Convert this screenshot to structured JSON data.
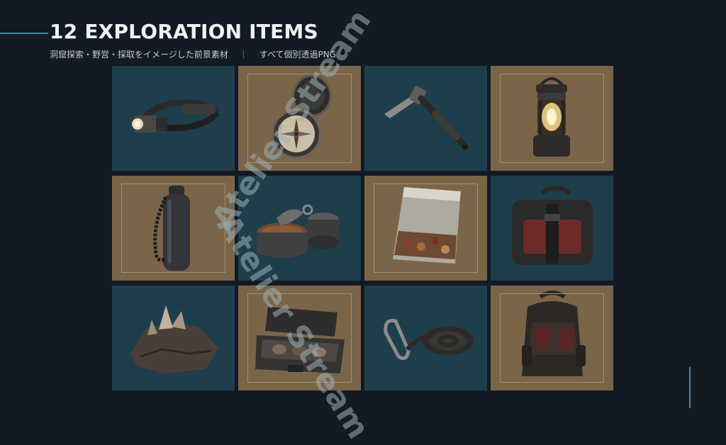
{
  "header": {
    "title": "12 EXPLORATION ITEMS",
    "subtitle": "洞窟探索・野営・採取をイメージした前景素材",
    "separator": "｜",
    "note": "すべて個別透過PNG"
  },
  "watermark": "Atelier Stream",
  "colors": {
    "background": "#121a24",
    "tile_teal": "#1e3e4b",
    "tile_sand": "#7b6548",
    "accent": "#3f8ea0"
  },
  "items": [
    {
      "icon": "headlamp-icon",
      "tile": "teal"
    },
    {
      "icon": "compass-icon",
      "tile": "sand"
    },
    {
      "icon": "pickaxe-hammer-icon",
      "tile": "teal"
    },
    {
      "icon": "lantern-icon",
      "tile": "sand"
    },
    {
      "icon": "water-bottle-icon",
      "tile": "sand"
    },
    {
      "icon": "tin-cans-icon",
      "tile": "teal"
    },
    {
      "icon": "food-pouch-icon",
      "tile": "sand"
    },
    {
      "icon": "pouch-bag-icon",
      "tile": "teal"
    },
    {
      "icon": "crystal-rock-icon",
      "tile": "teal"
    },
    {
      "icon": "sample-case-icon",
      "tile": "sand"
    },
    {
      "icon": "rope-carabiner-icon",
      "tile": "teal"
    },
    {
      "icon": "backpack-icon",
      "tile": "sand"
    }
  ]
}
